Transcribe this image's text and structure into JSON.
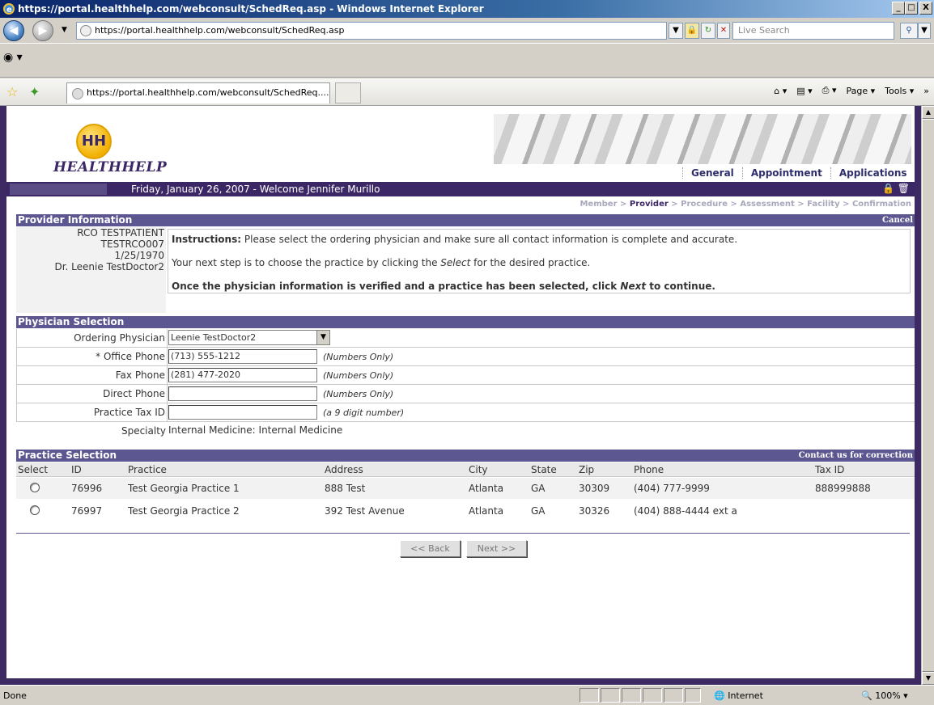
{
  "window": {
    "title": "https://portal.healthhelp.com/webconsult/SchedReq.asp - Windows Internet Explorer",
    "min": "_",
    "max": "□",
    "close": "X"
  },
  "browser": {
    "address": "https://portal.healthhelp.com/webconsult/SchedReq.asp",
    "search_placeholder": "Live Search",
    "tab_title": "https://portal.healthhelp.com/webconsult/SchedReq....",
    "cmd": {
      "home": "⌂ ▾",
      "feeds": "▤ ▾",
      "print": "⎙ ▾",
      "page": "Page ▾",
      "tools": "Tools ▾",
      "more": "»"
    },
    "status": "Done",
    "zone": "Internet",
    "zoom": "100%"
  },
  "header": {
    "logo_mark": "HH",
    "logo_text": "HEALTHHELP",
    "nav": [
      "General",
      "Appointment",
      "Applications"
    ],
    "welcome": "Friday, January 26, 2007 - Welcome Jennifer Murillo",
    "icons": "🔒 🗑"
  },
  "breadcrumb": {
    "member": "Member >",
    "provider": "Provider",
    "rest": "> Procedure > Assessment > Facility > Confirmation"
  },
  "provider_info": {
    "title": "Provider Information",
    "cancel": "Cancel",
    "patient_name": "RCO TESTPATIENT",
    "patient_id": "TESTRCO007",
    "dob": "1/25/1970",
    "doctor": "Dr. Leenie TestDoctor2",
    "instr_label": "Instructions:",
    "instr_1": "Please select the ordering physician and make sure all contact information is complete and accurate.",
    "instr_2a": "Your next step is to choose the practice by clicking the",
    "instr_2b": "Select",
    "instr_2c": "for the desired practice.",
    "instr_3a": "Once the physician information is verified and a practice has been selected, click",
    "instr_3b": "Next",
    "instr_3c": "to continue."
  },
  "physician": {
    "title": "Physician Selection",
    "ordering_label": "Ordering Physician",
    "ordering_value": "Leenie TestDoctor2",
    "office_label": "* Office Phone",
    "office_value": "(713) 555-1212",
    "fax_label": "Fax Phone",
    "fax_value": "(281) 477-2020",
    "direct_label": "Direct Phone",
    "direct_value": "",
    "tax_label": "Practice Tax ID",
    "tax_value": "",
    "numbers_only": "(Numbers Only)",
    "tax_hint": "(a 9 digit number)",
    "specialty_label": "Specialty",
    "specialty_value": "Internal Medicine: Internal Medicine"
  },
  "practice": {
    "title": "Practice Selection",
    "contact": "Contact us for correction",
    "columns": [
      "Select",
      "ID",
      "Practice",
      "Address",
      "City",
      "State",
      "Zip",
      "Phone",
      "Tax ID"
    ],
    "rows": [
      {
        "id": "76996",
        "name": "Test Georgia Practice 1",
        "address": "888 Test",
        "city": "Atlanta",
        "state": "GA",
        "zip": "30309",
        "phone": "(404) 777-9999",
        "tax": "888999888"
      },
      {
        "id": "76997",
        "name": "Test Georgia Practice 2",
        "address": "392 Test Avenue",
        "city": "Atlanta",
        "state": "GA",
        "zip": "30326",
        "phone": "(404) 888-4444 ext a",
        "tax": ""
      }
    ]
  },
  "buttons": {
    "back": "<< Back",
    "next": "Next >>"
  }
}
